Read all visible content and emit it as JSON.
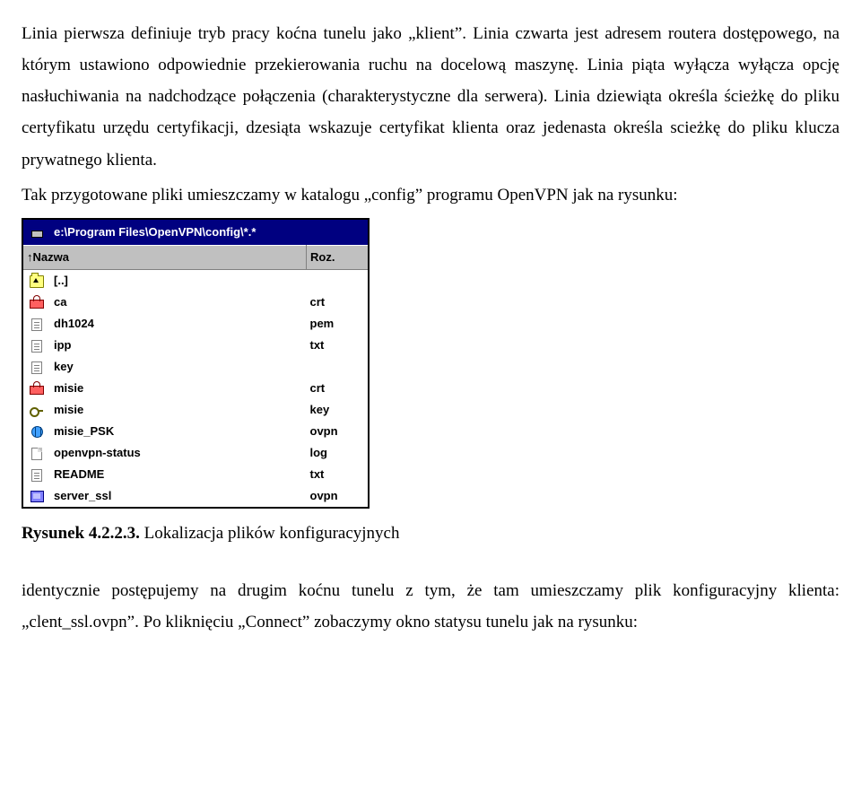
{
  "para1": "Linia pierwsza definiuje tryb pracy koćna tunelu jako „klient”. Linia czwarta jest adresem routera dostępowego, na którym ustawiono odpowiednie przekierowania ruchu na docelową maszynę. Linia piąta wyłącza wyłącza opcję nasłuchiwania na nadchodzące połączenia (charakterystyczne dla serwera). Linia dziewiąta określa ścieżkę do pliku certyfikatu urzędu certyfikacji, dzesiąta wskazuje certyfikat klienta oraz jedenasta określa scieżkę do pliku klucza prywatnego klienta.",
  "para2": "Tak przygotowane pliki umieszczamy w katalogu „config” programu OpenVPN jak na rysunku:",
  "filemanager": {
    "path": "e:\\Program Files\\OpenVPN\\config\\*.*",
    "col_name": "↑Nazwa",
    "col_ext": "Roz.",
    "rows": [
      {
        "icon": "folder",
        "name": "[..]",
        "ext": ""
      },
      {
        "icon": "lock",
        "name": "ca",
        "ext": "crt"
      },
      {
        "icon": "doc",
        "name": "dh1024",
        "ext": "pem"
      },
      {
        "icon": "doc",
        "name": "ipp",
        "ext": "txt"
      },
      {
        "icon": "doc",
        "name": "key",
        "ext": ""
      },
      {
        "icon": "lock",
        "name": "misie",
        "ext": "crt"
      },
      {
        "icon": "key",
        "name": "misie",
        "ext": "key"
      },
      {
        "icon": "net",
        "name": "misie_PSK",
        "ext": "ovpn"
      },
      {
        "icon": "log",
        "name": "openvpn-status",
        "ext": "log"
      },
      {
        "icon": "doc",
        "name": "README",
        "ext": "txt"
      },
      {
        "icon": "sys",
        "name": "server_ssl",
        "ext": "ovpn"
      }
    ]
  },
  "caption_bold": "Rysunek 4.2.2.3.",
  "caption_rest": " Lokalizacja plików konfiguracyjnych",
  "para3": "identycznie postępujemy na drugim koćnu tunelu z tym, że tam umieszczamy plik konfiguracyjny klienta: „clent_ssl.ovpn”. Po kliknięciu „Connect” zobaczymy okno statysu tunelu jak na rysunku:"
}
